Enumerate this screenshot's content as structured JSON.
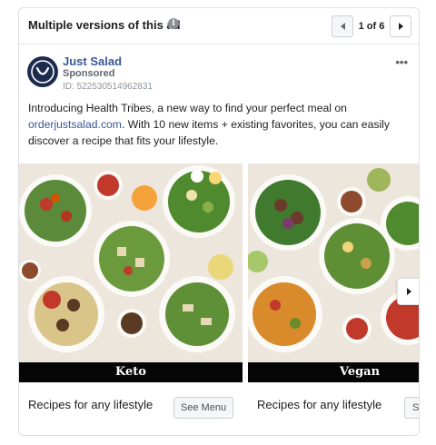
{
  "header": {
    "title": "Multiple versions of this ad",
    "info_icon": "info-icon",
    "pager_text": "1 of 6"
  },
  "advertiser": {
    "name": "Just Salad",
    "sponsored": "Sponsored",
    "ad_id": "ID: 522530514962831",
    "more_icon": "more-dots-icon",
    "more_label": "•••"
  },
  "body": {
    "text_before": "Introducing Health Tribes, a new way to find your perfect meal on ",
    "link": "orderjustsalad.com",
    "text_after": ". With 10 new items + existing favorites, you can easily discover a recipe that fits your lifestyle."
  },
  "slides": [
    {
      "label": "Keto",
      "caption": "Recipes for any lifestyle",
      "button": "See Menu"
    },
    {
      "label": "Vegan",
      "caption": "Recipes for any lifestyle",
      "button": "See Menu"
    }
  ],
  "colors": {
    "link": "#385898",
    "band": "#050505",
    "border": "#dddfe2",
    "logo_bg": "#1d2b4f"
  }
}
